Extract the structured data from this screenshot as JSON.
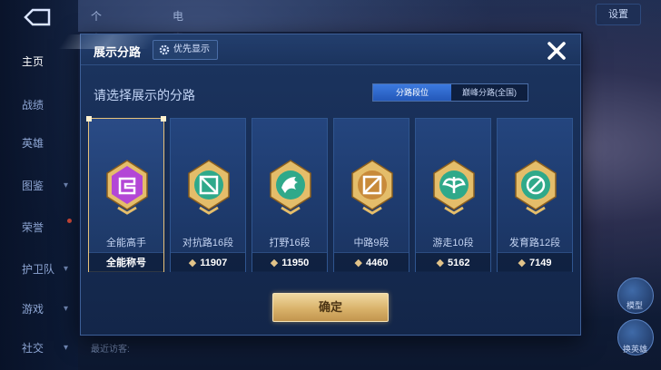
{
  "background": {
    "sidebar": [
      {
        "label": "主页",
        "active": true
      },
      {
        "label": "战绩"
      },
      {
        "label": "英雄"
      },
      {
        "label": "图鉴"
      },
      {
        "label": "荣誉"
      },
      {
        "label": "护卫队"
      },
      {
        "label": "游戏"
      },
      {
        "label": "社交"
      }
    ],
    "top_tabs": [
      "个人主页",
      "电竞号"
    ],
    "settings_label": "设置",
    "bottom_text": "最近访客:",
    "right_labels": [
      "模型",
      "换英雄"
    ]
  },
  "dialog": {
    "title": "展示分路",
    "priority_label": "优先显示",
    "subtitle": "请选择展示的分路",
    "segments": [
      {
        "label": "分路段位",
        "active": true
      },
      {
        "label": "巅峰分路(全国)",
        "active": false
      }
    ],
    "cards": [
      {
        "name": "全能高手",
        "stat": "全能称号",
        "emblem_icon": "all-round-emblem-icon",
        "selected": true,
        "accent": "#b347d6"
      },
      {
        "name": "对抗路16段",
        "stat": "11907",
        "emblem_icon": "clash-lane-emblem-icon",
        "selected": false,
        "accent": "#2fa98a"
      },
      {
        "name": "打野16段",
        "stat": "11950",
        "emblem_icon": "jungle-emblem-icon",
        "selected": false,
        "accent": "#2fa98a"
      },
      {
        "name": "中路9段",
        "stat": "4460",
        "emblem_icon": "mid-lane-emblem-icon",
        "selected": false,
        "accent": "#c88a3a"
      },
      {
        "name": "游走10段",
        "stat": "5162",
        "emblem_icon": "roam-emblem-icon",
        "selected": false,
        "accent": "#2fa98a"
      },
      {
        "name": "发育路12段",
        "stat": "7149",
        "emblem_icon": "farm-lane-emblem-icon",
        "selected": false,
        "accent": "#2fa98a"
      }
    ],
    "confirm_label": "确定"
  },
  "colors": {
    "gold": "#e2c389",
    "panel": "#1c3560",
    "segment_active": "#2f68cc"
  }
}
